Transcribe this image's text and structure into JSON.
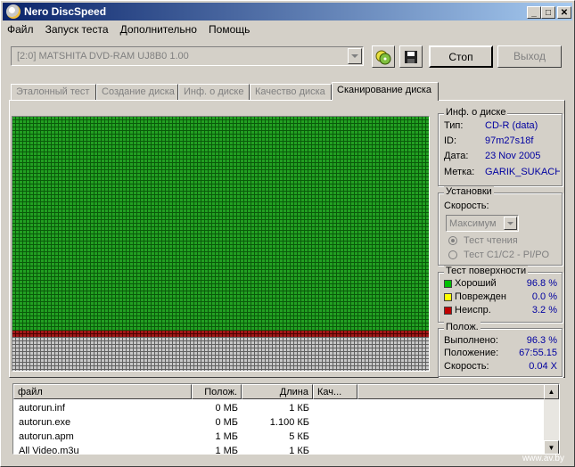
{
  "window": {
    "title": "Nero DiscSpeed",
    "min_glyph": "_",
    "max_glyph": "□",
    "close_glyph": "✕"
  },
  "menu": [
    "Файл",
    "Запуск теста",
    "Дополнительно",
    "Помощь"
  ],
  "toolbar": {
    "drive": "[2:0]  MATSHITA DVD-RAM UJ8B0 1.00",
    "stop_label": "Стоп",
    "exit_label": "Выход"
  },
  "tabs": [
    {
      "label": "Эталонный тест",
      "active": false
    },
    {
      "label": "Создание диска",
      "active": false
    },
    {
      "label": "Инф. о диске",
      "active": false
    },
    {
      "label": "Качество диска",
      "active": false
    },
    {
      "label": "Сканирование диска",
      "active": true
    }
  ],
  "disc_info": {
    "legend": "Инф. о диске",
    "rows": [
      {
        "label": "Тип:",
        "value": "CD-R (data)"
      },
      {
        "label": "ID:",
        "value": "97m27s18f"
      },
      {
        "label": "Дата:",
        "value": "23 Nov 2005"
      },
      {
        "label": "Метка:",
        "value": "GARIK_SUKACHE"
      }
    ]
  },
  "settings": {
    "legend": "Установки",
    "speed_label": "Скорость:",
    "speed_value": "Максимум",
    "radio_read": "Тест чтения",
    "radio_c1c2": "Тест C1/C2 - PI/PO"
  },
  "surface": {
    "legend": "Тест поверхности",
    "rows": [
      {
        "label": "Хороший",
        "value": "96.8 %",
        "color": "#00c000"
      },
      {
        "label": "Поврежден",
        "value": "0.0 %",
        "color": "#ffff00"
      },
      {
        "label": "Неиспр.",
        "value": "3.2 %",
        "color": "#c00000"
      }
    ]
  },
  "position": {
    "legend": "Полож.",
    "rows": [
      {
        "label": "Выполнено:",
        "value": "96.3 %"
      },
      {
        "label": "Положение:",
        "value": "67:55.15"
      },
      {
        "label": "Скорость:",
        "value": "0.04 X"
      }
    ]
  },
  "scan_map": {
    "good_fraction": 0.837,
    "damaged_fraction": 0.026,
    "colors": {
      "good": "#22a022",
      "bad": "#a01818",
      "unread": "#b8b8b8"
    }
  },
  "file_list": {
    "columns": [
      "файл",
      "Полож.",
      "Длина",
      "Кач..."
    ],
    "rows": [
      [
        "autorun.inf",
        "0 МБ",
        "1 КБ",
        ""
      ],
      [
        "autorun.exe",
        "0 МБ",
        "1.100 КБ",
        ""
      ],
      [
        "autorun.apm",
        "1 МБ",
        "5 КБ",
        ""
      ],
      [
        "All Video.m3u",
        "1 МБ",
        "1 КБ",
        ""
      ]
    ]
  },
  "watermark": "www.av.by"
}
